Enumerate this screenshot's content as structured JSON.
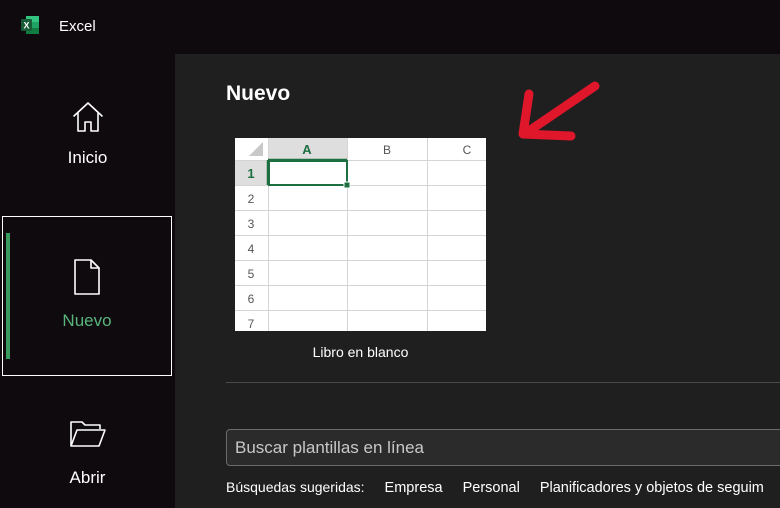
{
  "app": {
    "title": "Excel",
    "icon": "excel-logo-icon",
    "icon_letter": "X"
  },
  "sidebar": {
    "items": [
      {
        "label": "Inicio",
        "icon": "home-icon",
        "selected": false
      },
      {
        "label": "Nuevo",
        "icon": "new-document-icon",
        "selected": true
      },
      {
        "label": "Abrir",
        "icon": "folder-open-icon",
        "selected": false
      }
    ]
  },
  "main": {
    "title": "Nuevo",
    "templates": [
      {
        "label": "Libro en blanco",
        "columns": [
          "A",
          "B",
          "C"
        ],
        "rows": [
          "1",
          "2",
          "3",
          "4",
          "5",
          "6",
          "7"
        ]
      }
    ],
    "search": {
      "placeholder": "Buscar plantillas en línea",
      "value": ""
    },
    "suggested": {
      "label": "Búsquedas sugeridas:",
      "links": [
        "Empresa",
        "Personal",
        "Planificadores y objetos de seguim"
      ]
    }
  },
  "annotation": {
    "type": "red-arrow",
    "color": "#e0162b"
  },
  "colors": {
    "accent": "#58b47c",
    "excel_green": "#1d6f42",
    "background": "#1f1f1f"
  }
}
